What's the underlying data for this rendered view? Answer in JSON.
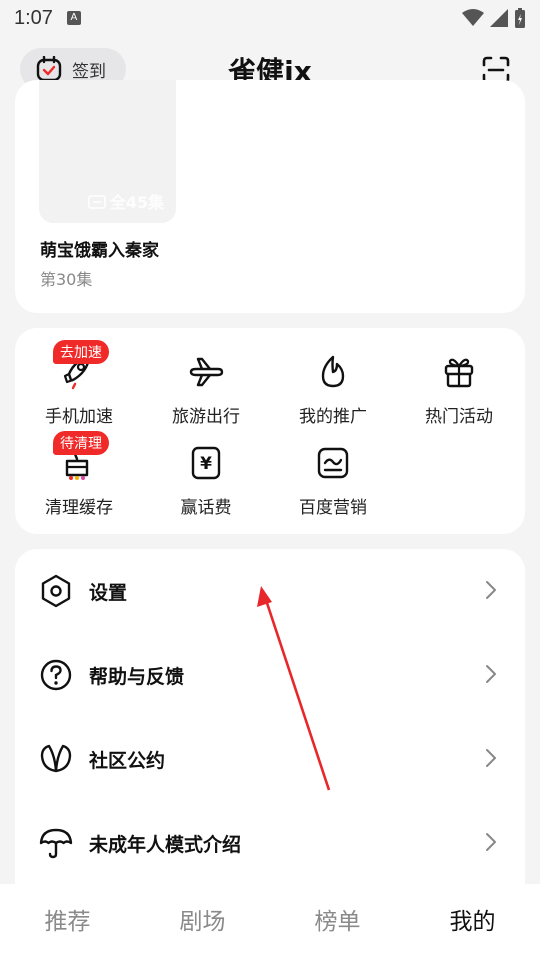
{
  "status_bar": {
    "time": "1:07",
    "notif_glyph": "A"
  },
  "header": {
    "checkin_label": "签到",
    "title": "雀健ix",
    "scan_icon": "scan-icon"
  },
  "history": {
    "episodes_label": "全45集",
    "drama_title": "萌宝饿霸入秦家",
    "episode": "第30集"
  },
  "tools": [
    {
      "label": "手机加速",
      "badge": "去加速",
      "icon": "rocket-icon"
    },
    {
      "label": "旅游出行",
      "icon": "airplane-icon"
    },
    {
      "label": "我的推广",
      "icon": "flame-icon"
    },
    {
      "label": "热门活动",
      "icon": "gift-icon"
    },
    {
      "label": "清理缓存",
      "badge": "待清理",
      "icon": "broom-icon"
    },
    {
      "label": "赢话费",
      "icon": "yen-icon"
    },
    {
      "label": "百度营销",
      "icon": "marketing-chart-icon"
    }
  ],
  "menu": [
    {
      "label": "设置",
      "icon": "gear-icon"
    },
    {
      "label": "帮助与反馈",
      "icon": "help-icon"
    },
    {
      "label": "社区公约",
      "icon": "leaf-icon"
    },
    {
      "label": "未成年人模式介绍",
      "icon": "umbrella-icon"
    }
  ],
  "tabs": [
    "推荐",
    "剧场",
    "榜单",
    "我的"
  ],
  "active_tab": "我的",
  "colors": {
    "badge": "#f02a28",
    "arrow": "#e8272a",
    "background": "#f4f4f5"
  }
}
